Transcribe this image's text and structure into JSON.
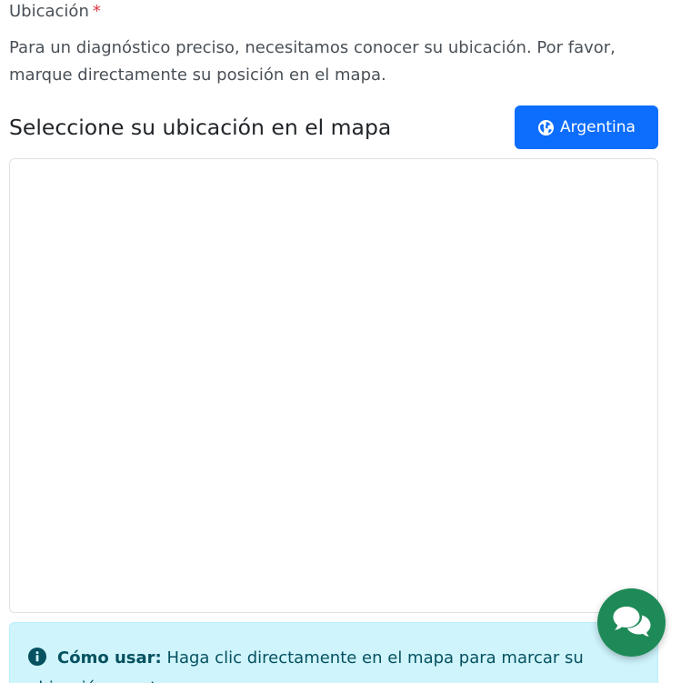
{
  "field": {
    "label": "Ubicación",
    "required_mark": "*",
    "help_text": "Para un diagnóstico preciso, necesitamos conocer su ubicación. Por favor, marque directamente su posición en el mapa."
  },
  "map_section": {
    "title": "Seleccione su ubicación en el mapa",
    "country_button_label": "Argentina",
    "country_button_icon": "globe-icon"
  },
  "info_alert": {
    "icon": "info-circle-icon",
    "strong_text": "Cómo usar:",
    "text": " Haga clic directamente en el mapa para marcar su ubicación exacta."
  },
  "chat_button": {
    "icon": "chat-bubbles-icon"
  },
  "colors": {
    "primary": "#0d6efd",
    "required": "#dc3545",
    "info_bg": "#cff4fc",
    "info_text": "#055160",
    "chat_fab": "#1e8a57"
  }
}
